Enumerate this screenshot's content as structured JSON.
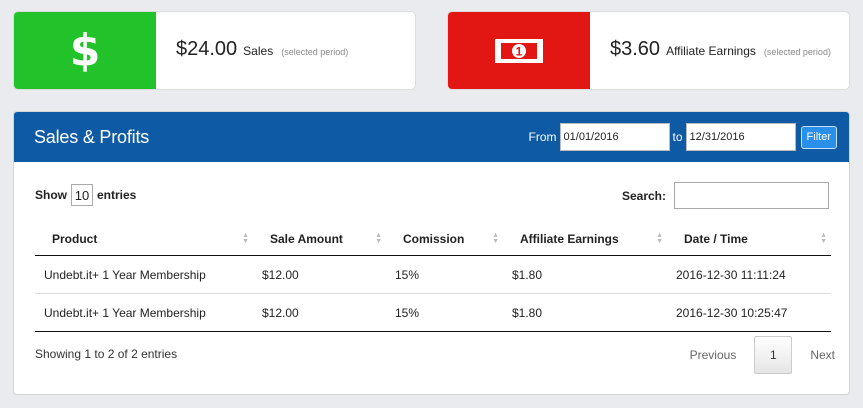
{
  "cards": [
    {
      "amount": "$24.00",
      "label": "Sales",
      "period": "(selected period)",
      "icon": "dollar-icon",
      "color": "#22c32a",
      "icon_glyph": "$"
    },
    {
      "amount": "$3.60",
      "label": "Affiliate Earnings",
      "period": "(selected period)",
      "icon": "money-bill-icon",
      "color": "#e21613",
      "icon_glyph": "1"
    }
  ],
  "panel": {
    "title": "Sales & Profits",
    "from_label": "From",
    "from_value": "01/01/2016",
    "to_label": "to",
    "to_value": "12/31/2016",
    "filter_label": "Filter",
    "header_color": "#0f5aa5"
  },
  "table_controls": {
    "show_label": "Show",
    "page_length": "10",
    "entries_label": "entries",
    "search_label": "Search:"
  },
  "table": {
    "columns": [
      "Product",
      "Sale Amount",
      "Comission",
      "Affiliate Earnings",
      "Date / Time"
    ],
    "rows": [
      [
        "Undebt.it+ 1 Year Membership",
        "$12.00",
        "15%",
        "$1.80",
        "2016-12-30 11:11:24"
      ],
      [
        "Undebt.it+ 1 Year Membership",
        "$12.00",
        "15%",
        "$1.80",
        "2016-12-30 10:25:47"
      ]
    ]
  },
  "footer": {
    "info": "Showing 1 to 2 of 2 entries",
    "prev": "Previous",
    "current_page": "1",
    "next": "Next"
  }
}
